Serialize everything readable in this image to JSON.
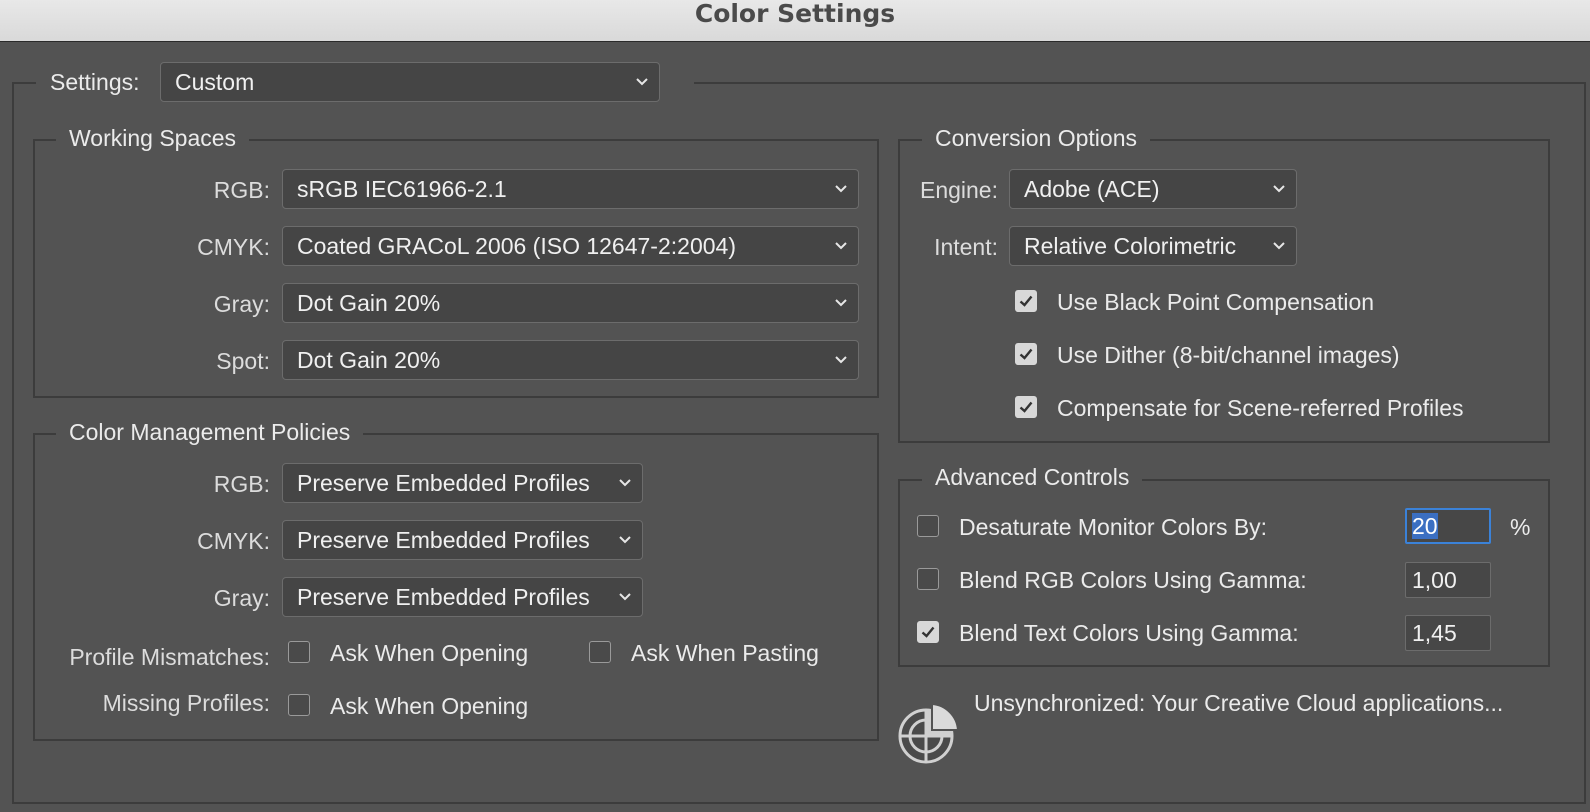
{
  "window": {
    "title": "Color Settings"
  },
  "settings": {
    "label": "Settings:",
    "value": "Custom"
  },
  "working_spaces": {
    "title": "Working Spaces",
    "rows": [
      {
        "label": "RGB:",
        "value": "sRGB IEC61966-2.1"
      },
      {
        "label": "CMYK:",
        "value": "Coated GRACoL 2006 (ISO 12647-2:2004)"
      },
      {
        "label": "Gray:",
        "value": "Dot Gain 20%"
      },
      {
        "label": "Spot:",
        "value": "Dot Gain 20%"
      }
    ]
  },
  "policies": {
    "title": "Color Management Policies",
    "rows": [
      {
        "label": "RGB:",
        "value": "Preserve Embedded Profiles"
      },
      {
        "label": "CMYK:",
        "value": "Preserve Embedded Profiles"
      },
      {
        "label": "Gray:",
        "value": "Preserve Embedded Profiles"
      }
    ],
    "mismatch_label": "Profile Mismatches:",
    "ask_opening": "Ask When Opening",
    "ask_pasting": "Ask When Pasting",
    "missing_label": "Missing Profiles:",
    "missing_ask_opening": "Ask When Opening"
  },
  "conversion": {
    "title": "Conversion Options",
    "engine_label": "Engine:",
    "engine_value": "Adobe (ACE)",
    "intent_label": "Intent:",
    "intent_value": "Relative Colorimetric",
    "black_point": "Use Black Point Compensation",
    "dither": "Use Dither (8-bit/channel images)",
    "scene_referred": "Compensate for Scene-referred Profiles"
  },
  "advanced": {
    "title": "Advanced Controls",
    "desaturate_label": "Desaturate Monitor Colors By:",
    "desaturate_value": "20",
    "percent": "%",
    "blend_rgb_label": "Blend RGB Colors Using Gamma:",
    "blend_rgb_value": "1,00",
    "blend_text_label": "Blend Text Colors Using Gamma:",
    "blend_text_value": "1,45"
  },
  "sync": {
    "message": "Unsynchronized: Your Creative Cloud applications..."
  },
  "icons": {
    "dropdown": "chevron-down-icon",
    "check": "checkmark-icon",
    "sync": "sync-status-icon"
  },
  "colors": {
    "background": "#535353",
    "focus": "#3b82d8"
  }
}
